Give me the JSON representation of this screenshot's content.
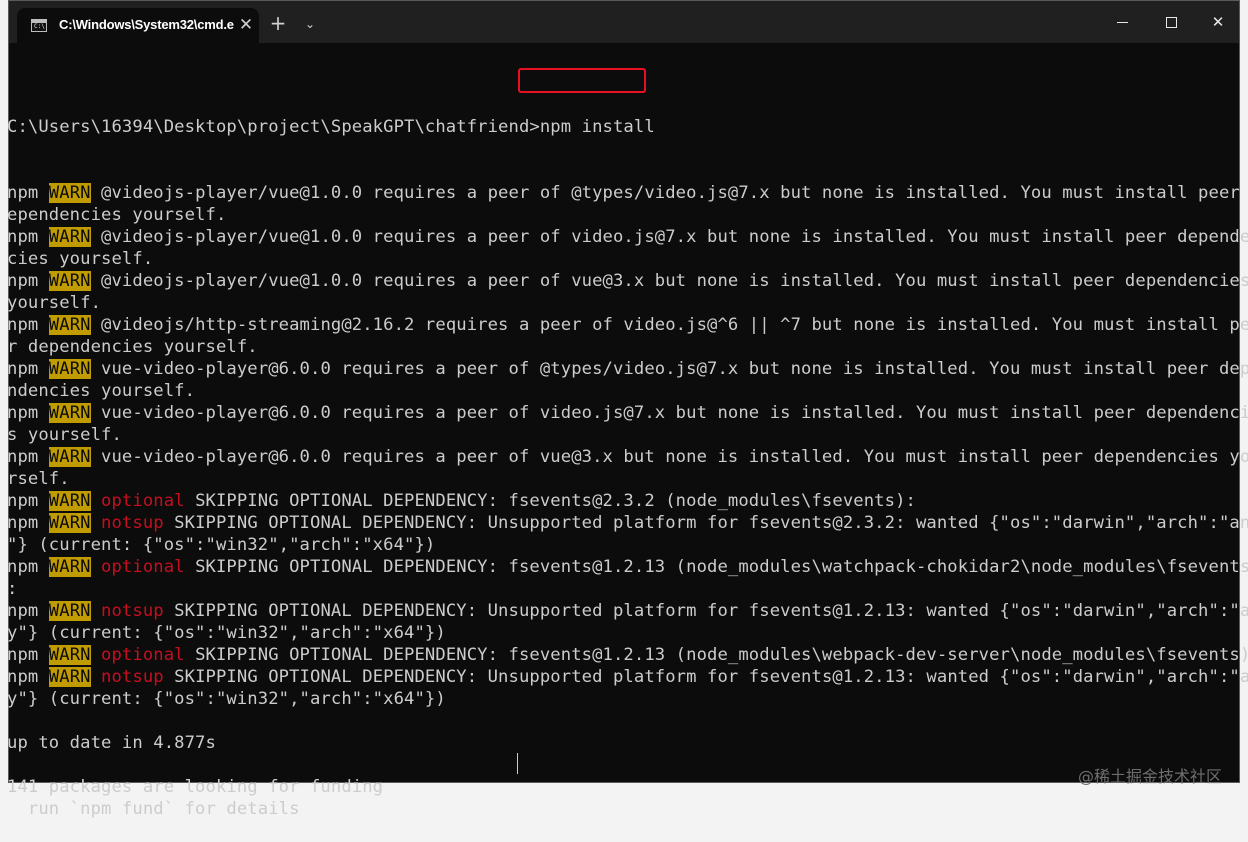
{
  "window": {
    "tab_title": "C:\\Windows\\System32\\cmd.e",
    "tab_icon_text": "C:\\",
    "tab_close": "✕",
    "new_tab": "+",
    "dropdown": "⌄",
    "close": "✕"
  },
  "colors": {
    "background": "#0c0c0c",
    "text": "#cccccc",
    "warn_bg": "#c19c00",
    "tag": "#c50f1f",
    "highlight_box": "#e81123"
  },
  "terminal": {
    "prompt": "C:\\Users\\16394\\Desktop\\project\\SpeakGPT\\chatfriend>",
    "command": "npm install",
    "lines": [
      {
        "p": "npm ",
        "w": "WARN",
        "t": "",
        "r": " @videojs-player/vue@1.0.0 requires a peer of @types/video.js@7.x but none is installed. You must install peer d"
      },
      {
        "p": "",
        "w": "",
        "t": "",
        "r": "ependencies yourself."
      },
      {
        "p": "npm ",
        "w": "WARN",
        "t": "",
        "r": " @videojs-player/vue@1.0.0 requires a peer of video.js@7.x but none is installed. You must install peer dependen"
      },
      {
        "p": "",
        "w": "",
        "t": "",
        "r": "cies yourself."
      },
      {
        "p": "npm ",
        "w": "WARN",
        "t": "",
        "r": " @videojs-player/vue@1.0.0 requires a peer of vue@3.x but none is installed. You must install peer dependencies"
      },
      {
        "p": "",
        "w": "",
        "t": "",
        "r": "yourself."
      },
      {
        "p": "npm ",
        "w": "WARN",
        "t": "",
        "r": " @videojs/http-streaming@2.16.2 requires a peer of video.js@^6 || ^7 but none is installed. You must install pee"
      },
      {
        "p": "",
        "w": "",
        "t": "",
        "r": "r dependencies yourself."
      },
      {
        "p": "npm ",
        "w": "WARN",
        "t": "",
        "r": " vue-video-player@6.0.0 requires a peer of @types/video.js@7.x but none is installed. You must install peer depe"
      },
      {
        "p": "",
        "w": "",
        "t": "",
        "r": "ndencies yourself."
      },
      {
        "p": "npm ",
        "w": "WARN",
        "t": "",
        "r": " vue-video-player@6.0.0 requires a peer of video.js@7.x but none is installed. You must install peer dependencie"
      },
      {
        "p": "",
        "w": "",
        "t": "",
        "r": "s yourself."
      },
      {
        "p": "npm ",
        "w": "WARN",
        "t": "",
        "r": " vue-video-player@6.0.0 requires a peer of vue@3.x but none is installed. You must install peer dependencies you"
      },
      {
        "p": "",
        "w": "",
        "t": "",
        "r": "rself."
      },
      {
        "p": "npm ",
        "w": "WARN",
        "t": " optional",
        "r": " SKIPPING OPTIONAL DEPENDENCY: fsevents@2.3.2 (node_modules\\fsevents):"
      },
      {
        "p": "npm ",
        "w": "WARN",
        "t": " notsup",
        "r": " SKIPPING OPTIONAL DEPENDENCY: Unsupported platform for fsevents@2.3.2: wanted {\"os\":\"darwin\",\"arch\":\"any"
      },
      {
        "p": "",
        "w": "",
        "t": "",
        "r": "\"} (current: {\"os\":\"win32\",\"arch\":\"x64\"})"
      },
      {
        "p": "npm ",
        "w": "WARN",
        "t": " optional",
        "r": " SKIPPING OPTIONAL DEPENDENCY: fsevents@1.2.13 (node_modules\\watchpack-chokidar2\\node_modules\\fsevents)"
      },
      {
        "p": "",
        "w": "",
        "t": "",
        "r": ":"
      },
      {
        "p": "npm ",
        "w": "WARN",
        "t": " notsup",
        "r": " SKIPPING OPTIONAL DEPENDENCY: Unsupported platform for fsevents@1.2.13: wanted {\"os\":\"darwin\",\"arch\":\"an"
      },
      {
        "p": "",
        "w": "",
        "t": "",
        "r": "y\"} (current: {\"os\":\"win32\",\"arch\":\"x64\"})"
      },
      {
        "p": "npm ",
        "w": "WARN",
        "t": " optional",
        "r": " SKIPPING OPTIONAL DEPENDENCY: fsevents@1.2.13 (node_modules\\webpack-dev-server\\node_modules\\fsevents):"
      },
      {
        "p": "npm ",
        "w": "WARN",
        "t": " notsup",
        "r": " SKIPPING OPTIONAL DEPENDENCY: Unsupported platform for fsevents@1.2.13: wanted {\"os\":\"darwin\",\"arch\":\"an"
      },
      {
        "p": "",
        "w": "",
        "t": "",
        "r": "y\"} (current: {\"os\":\"win32\",\"arch\":\"x64\"})"
      },
      {
        "p": "",
        "w": "",
        "t": "",
        "r": ""
      },
      {
        "p": "",
        "w": "",
        "t": "",
        "r": "up to date in 4.877s"
      },
      {
        "p": "",
        "w": "",
        "t": "",
        "r": ""
      },
      {
        "p": "",
        "w": "",
        "t": "",
        "r": "141 packages are looking for funding"
      },
      {
        "p": "",
        "w": "",
        "t": "",
        "r": "  run `npm fund` for details"
      }
    ]
  },
  "watermark": "@稀土掘金技术社区"
}
